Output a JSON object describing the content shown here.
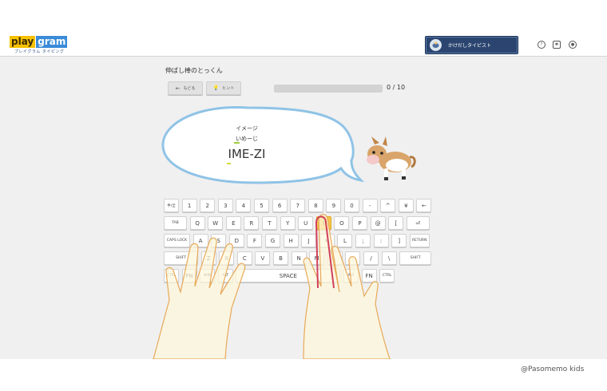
{
  "header": {
    "logo_main_a": "play",
    "logo_main_b": "gram",
    "logo_sub": "プレイグラム タイピング",
    "user_name": "かけだしタイピスト",
    "icons": [
      "help-icon",
      "settings-icon",
      "account-icon"
    ]
  },
  "lesson": {
    "title": "伸ばし棒のとっくん",
    "back_label": "もどる",
    "hint_label": "ヒント",
    "progress_text": "0 / 10",
    "progress_fraction": 0.0
  },
  "question": {
    "hint": "イメージ",
    "kana": "いめーじ",
    "romaji": "IME-ZI"
  },
  "keyboard": {
    "row1": [
      "半/全",
      "1",
      "2",
      "3",
      "4",
      "5",
      "6",
      "7",
      "8",
      "9",
      "0",
      "-",
      "^",
      "¥",
      "←"
    ],
    "row2": [
      "TAB",
      "Q",
      "W",
      "E",
      "R",
      "T",
      "Y",
      "U",
      "I",
      "O",
      "P",
      "@",
      "[",
      "⏎"
    ],
    "row3": [
      "CAPS LOCK",
      "A",
      "S",
      "D",
      "F",
      "G",
      "H",
      "J",
      "K",
      "L",
      ";",
      ":",
      "]",
      "RETURN"
    ],
    "row4": [
      "SHIFT",
      "Z",
      "X",
      "C",
      "V",
      "B",
      "N",
      "M",
      ",",
      ".",
      "/",
      "\\",
      "SHIFT"
    ],
    "row5": [
      "CTRL",
      "FN",
      "WIN",
      "ALT",
      "SPACE",
      "ALT",
      "FN",
      "CTRL"
    ],
    "highlight": "I"
  },
  "colors": {
    "highlight_key": "#f6c64a",
    "finger_highlight": "#d1405a",
    "user_button": "#2b4570",
    "bubble_border": "#8fc3e6"
  },
  "credit": "@Pasomemo kids"
}
